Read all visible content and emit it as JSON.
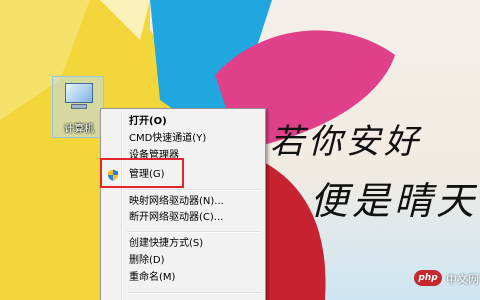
{
  "desktop": {
    "computer_icon": {
      "label": "计算机",
      "icon": "computer-icon"
    },
    "wallpaper": {
      "line1": "若你安好",
      "line2": "便是晴天"
    }
  },
  "context_menu": {
    "items": [
      {
        "label": "打开(O)",
        "bold": true
      },
      {
        "label": "CMD快速通道(Y)"
      },
      {
        "label": "设备管理器"
      },
      {
        "label": "管理(G)",
        "icon": "shield-icon",
        "highlighted": true
      },
      {
        "label": "映射网络驱动器(N)..."
      },
      {
        "label": "断开网络驱动器(C)..."
      },
      {
        "label": "创建快捷方式(S)"
      },
      {
        "label": "删除(D)"
      },
      {
        "label": "重命名(M)"
      }
    ]
  },
  "highlight_color": "#e2272b",
  "watermark": {
    "logo": "php",
    "text": "中文网"
  }
}
